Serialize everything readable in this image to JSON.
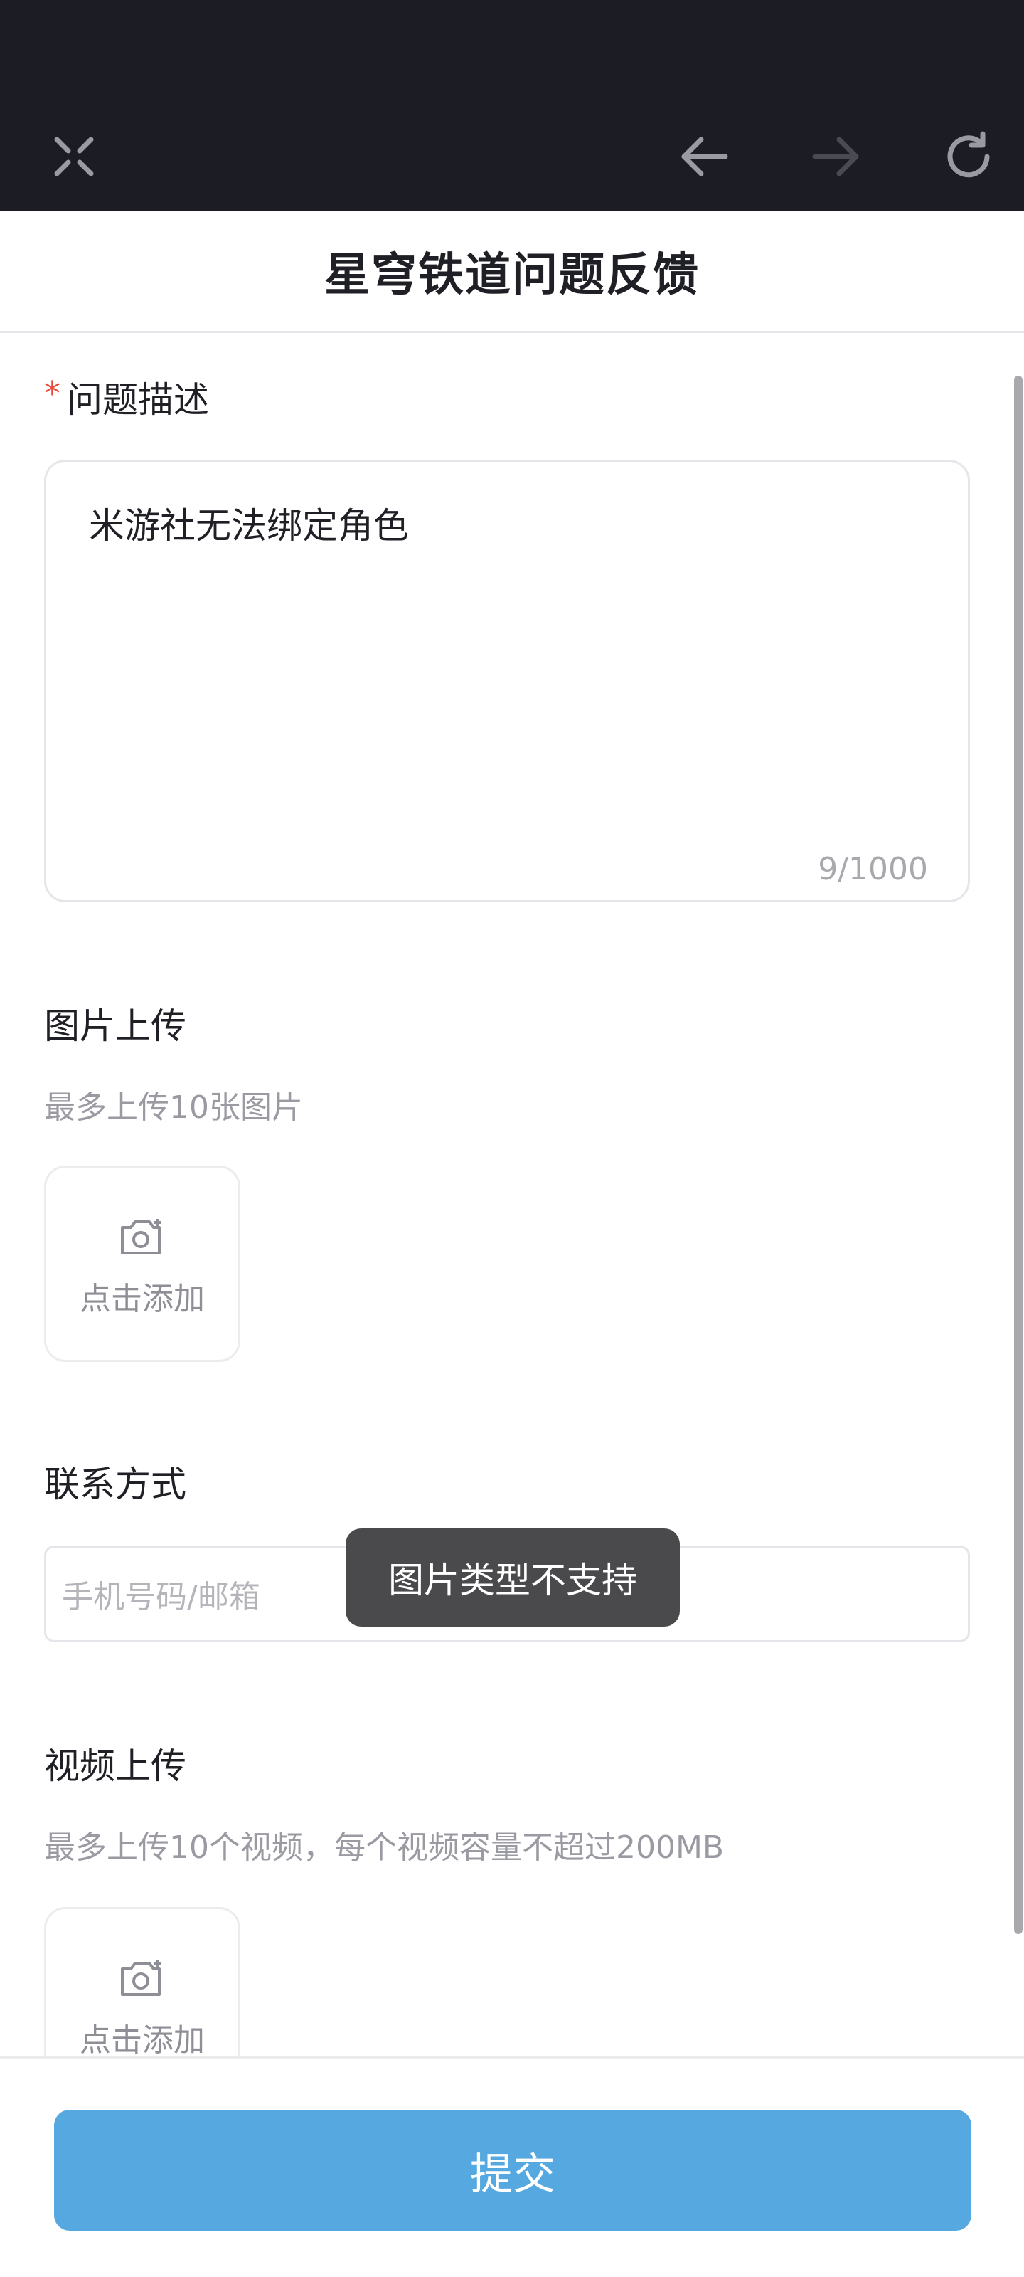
{
  "browser": {
    "close_icon": "close-icon",
    "back_icon": "arrow-left-icon",
    "forward_icon": "arrow-right-icon",
    "reload_icon": "reload-icon"
  },
  "page": {
    "title": "星穹铁道问题反馈"
  },
  "description": {
    "required_mark": "*",
    "label": "问题描述",
    "value": "米游社无法绑定角色",
    "counter": "9/1000"
  },
  "image_upload": {
    "label": "图片上传",
    "hint": "最多上传10张图片",
    "add_label": "点击添加"
  },
  "contact": {
    "label": "联系方式",
    "placeholder": "手机号码/邮箱"
  },
  "video_upload": {
    "label": "视频上传",
    "hint": "最多上传10个视频，每个视频容量不超过200MB",
    "add_label": "点击添加"
  },
  "toast": {
    "message": "图片类型不支持"
  },
  "footer": {
    "submit_label": "提交"
  },
  "colors": {
    "accent": "#55a9e0",
    "required": "#e74c3c",
    "toolbar_bg": "#1c1c24"
  }
}
